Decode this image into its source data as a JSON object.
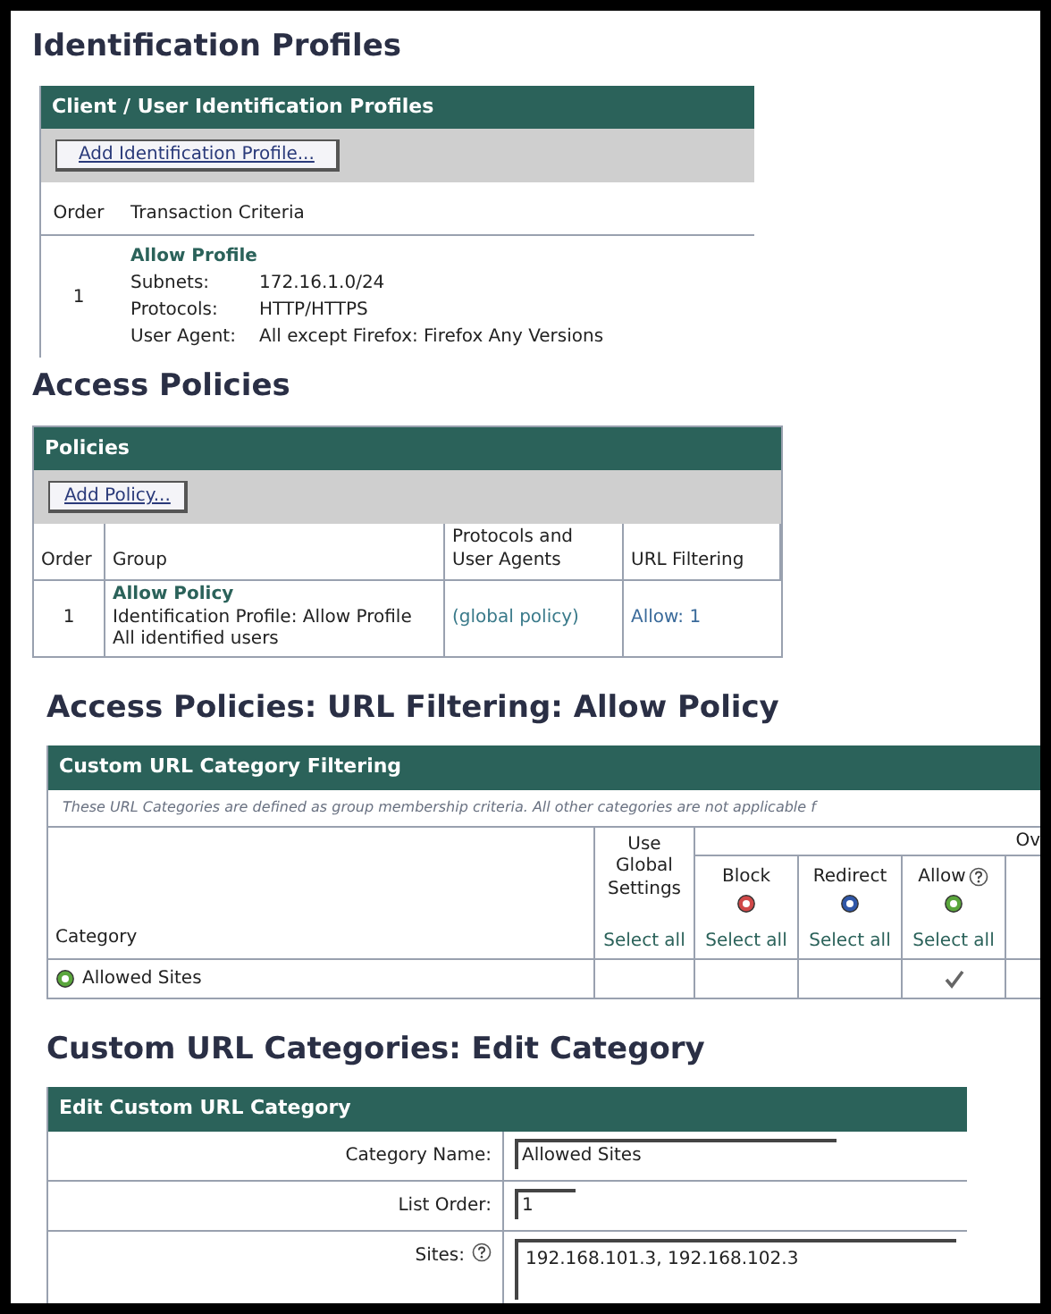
{
  "identification_profiles": {
    "heading": "Identification Profiles",
    "panel_title": "Client / User Identification Profiles",
    "add_button": "Add Identification Profile...",
    "columns": [
      "Order",
      "Transaction Criteria"
    ],
    "rows": [
      {
        "order": "1",
        "name": "Allow Profile",
        "criteria": [
          {
            "label": "Subnets:",
            "value": "172.16.1.0/24"
          },
          {
            "label": "Protocols:",
            "value": "HTTP/HTTPS"
          },
          {
            "label": "User Agent:",
            "value": "All except Firefox: Firefox Any Versions"
          }
        ]
      }
    ]
  },
  "access_policies": {
    "heading": "Access Policies",
    "panel_title": "Policies",
    "add_button": "Add Policy...",
    "columns": [
      "Order",
      "Group",
      "Protocols and User Agents",
      "URL Filtering"
    ],
    "rows": [
      {
        "order": "1",
        "name": "Allow Policy",
        "details": [
          "Identification Profile: Allow Profile",
          "All identified users"
        ],
        "protocols": "(global policy)",
        "url_filtering": "Allow: 1"
      }
    ]
  },
  "url_filtering": {
    "heading": "Access Policies: URL Filtering: Allow Policy",
    "panel_title": "Custom URL Category Filtering",
    "note": "These URL Categories are defined as group membership criteria. All other categories are not applicable f",
    "category_column": "Category",
    "global_column": "Use Global Settings",
    "override_group": "Ov",
    "select_all": "Select all",
    "actions": [
      {
        "kind": "block",
        "label": "Block",
        "help": false
      },
      {
        "kind": "redirect",
        "label": "Redirect",
        "help": false
      },
      {
        "kind": "allow",
        "label": "Allow",
        "help": true
      }
    ],
    "action_select_all": [
      "Select all",
      "Select all",
      "Select all"
    ],
    "rows": [
      {
        "category": "Allowed Sites",
        "checked": [
          false,
          false,
          true
        ]
      }
    ]
  },
  "edit_category": {
    "heading": "Custom URL Categories: Edit Category",
    "panel_title": "Edit Custom URL Category",
    "fields": [
      {
        "label": "Category Name:",
        "value": "Allowed Sites",
        "kind": "text",
        "help": false
      },
      {
        "label": "List Order:",
        "value": "1",
        "kind": "short",
        "help": false
      },
      {
        "label": "Sites:",
        "value": "192.168.101.3, 192.168.102.3",
        "kind": "area",
        "help": true
      }
    ]
  }
}
